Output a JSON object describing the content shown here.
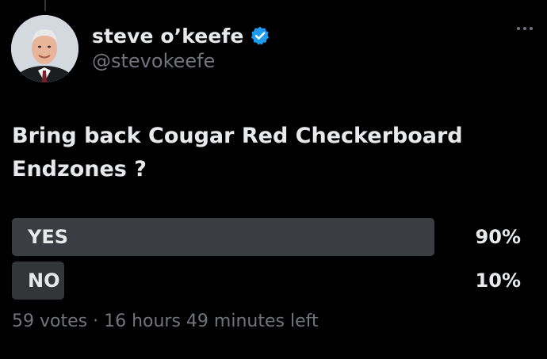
{
  "author": {
    "display_name": "steve o’keefe",
    "handle": "@stevokeefe",
    "verified": true,
    "avatar_icon": "profile-photo",
    "verified_icon": "verified-badge-icon",
    "more_icon": "more-options-icon"
  },
  "tweet": {
    "text": "Bring back Cougar Red Checkerboard Endzones ?"
  },
  "poll": {
    "options": [
      {
        "label": "YES",
        "percent": "90%",
        "share": 0.9,
        "winning": true
      },
      {
        "label": "NO",
        "percent": "10%",
        "share": 0.1,
        "winning": false
      }
    ],
    "votes": "59 votes",
    "separator": "·",
    "time_left": "16 hours 49 minutes left"
  },
  "colors": {
    "background": "#000000",
    "primary_text": "#e7e9ea",
    "secondary_text": "#71767b",
    "verified_blue": "#1d9bf0",
    "poll_bar_winning": "#3a3e42",
    "poll_bar": "#333639"
  }
}
